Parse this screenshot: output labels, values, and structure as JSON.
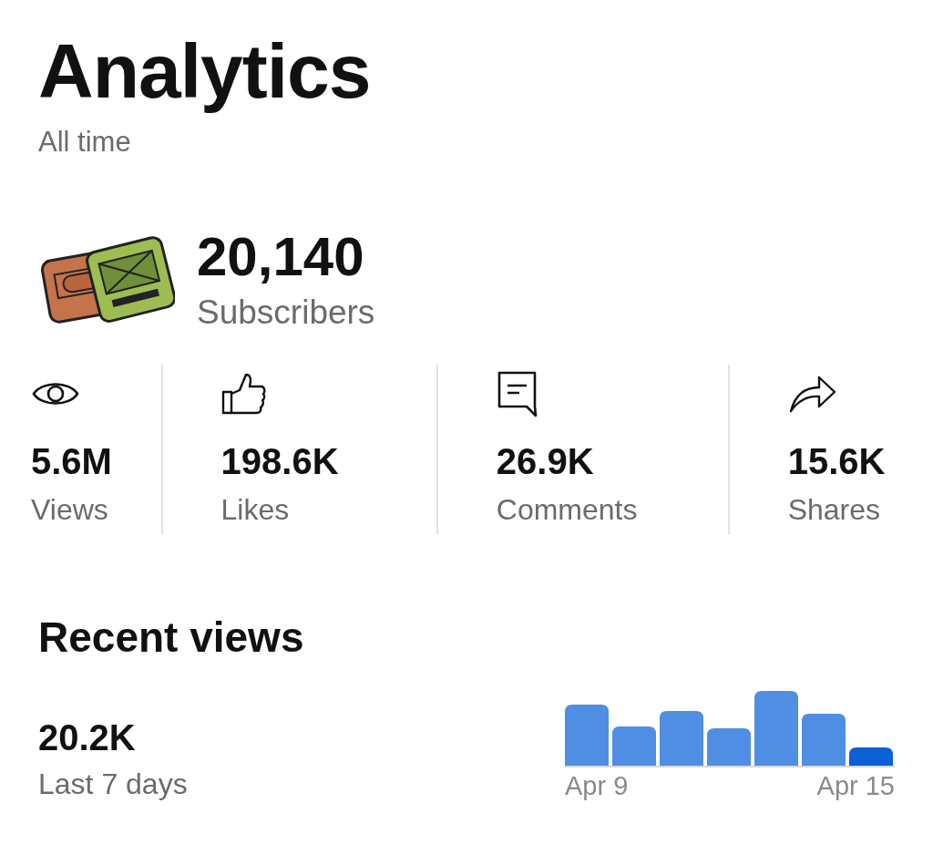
{
  "header": {
    "title": "Analytics",
    "subtitle": "All time"
  },
  "profile": {
    "count": "20,140",
    "label": "Subscribers"
  },
  "stats": [
    {
      "kind": "views",
      "value": "5.6M",
      "label": "Views"
    },
    {
      "kind": "likes",
      "value": "198.6K",
      "label": "Likes"
    },
    {
      "kind": "comments",
      "value": "26.9K",
      "label": "Comments"
    },
    {
      "kind": "shares",
      "value": "15.6K",
      "label": "Shares"
    }
  ],
  "recent_views": {
    "title": "Recent views",
    "value": "20.2K",
    "period": "Last 7 days",
    "start_label": "Apr 9",
    "end_label": "Apr 15"
  }
}
